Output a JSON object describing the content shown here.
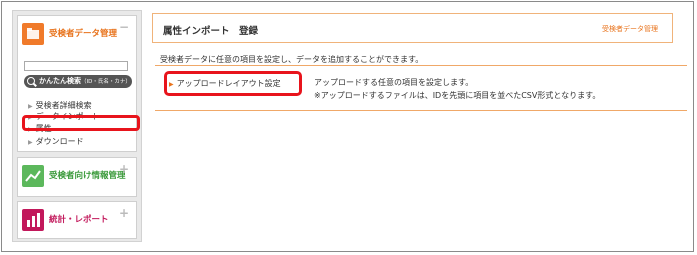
{
  "sidebar": {
    "panel1": {
      "title": "受検者データ管理",
      "search_label": "かんたん検索",
      "search_hint": "（ID・氏名・カナ）",
      "items": [
        {
          "label": "受検者詳細検索"
        },
        {
          "label": "データインポート"
        },
        {
          "label": "属性"
        },
        {
          "label": "ダウンロード"
        }
      ]
    },
    "panel2": {
      "title": "受検者向け情報管理"
    },
    "panel3": {
      "title": "統計・レポート"
    },
    "colors": {
      "panel1_icon": "#f07a2a",
      "panel2_icon": "#5cb85c",
      "panel3_icon": "#c2185b",
      "highlight": "#e8141c"
    }
  },
  "main": {
    "page_title": "属性インポート　登録",
    "section_label": "受検者データ管理",
    "description": "受検者データに任意の項目を設定し、データを追加することができます。",
    "upload_link": "アップロードレイアウト設定",
    "detail_line1": "アップロードする任意の項目を設定します。",
    "detail_line2": "※アップロードするファイルは、IDを先頭に項目を並べたCSV形式となります。",
    "colors": {
      "accent": "#e8731c",
      "border": "#f0b37a"
    }
  }
}
